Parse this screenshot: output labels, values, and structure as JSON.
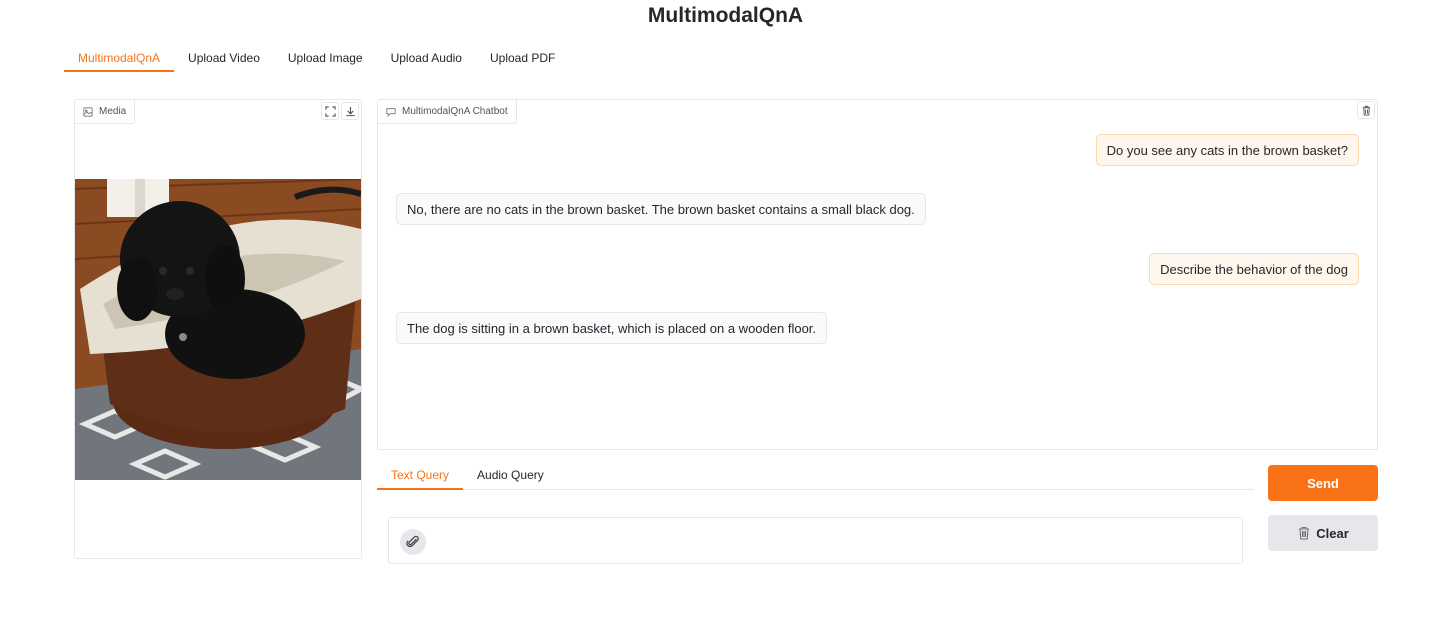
{
  "app": {
    "title": "MultimodalQnA"
  },
  "nav_tabs": [
    {
      "label": "MultimodalQnA",
      "active": true
    },
    {
      "label": "Upload Video",
      "active": false
    },
    {
      "label": "Upload Image",
      "active": false
    },
    {
      "label": "Upload Audio",
      "active": false
    },
    {
      "label": "Upload PDF",
      "active": false
    }
  ],
  "media": {
    "label": "Media",
    "icons": [
      "image-icon",
      "fullscreen-icon",
      "download-icon"
    ]
  },
  "chatbot": {
    "label": "MultimodalQnA Chatbot",
    "icons": [
      "chat-icon",
      "trash-icon"
    ],
    "messages": [
      {
        "role": "user",
        "text": "Do you see any cats in the brown basket?"
      },
      {
        "role": "bot",
        "text": "No, there are no cats in the brown basket. The brown basket contains a small black dog."
      },
      {
        "role": "user",
        "text": "Describe the behavior of the dog"
      },
      {
        "role": "bot",
        "text": "The dog is sitting in a brown basket, which is placed on a wooden floor."
      }
    ]
  },
  "query_tabs": [
    {
      "label": "Text Query",
      "active": true
    },
    {
      "label": "Audio Query",
      "active": false
    }
  ],
  "input": {
    "value": "",
    "placeholder": "",
    "icon": "paperclip-icon"
  },
  "buttons": {
    "send": "Send",
    "clear": "Clear",
    "clear_icon": "trash-icon"
  },
  "colors": {
    "accent": "#f97316",
    "user_bubble": "#fff7ed",
    "bot_bubble": "#f9fafb"
  }
}
